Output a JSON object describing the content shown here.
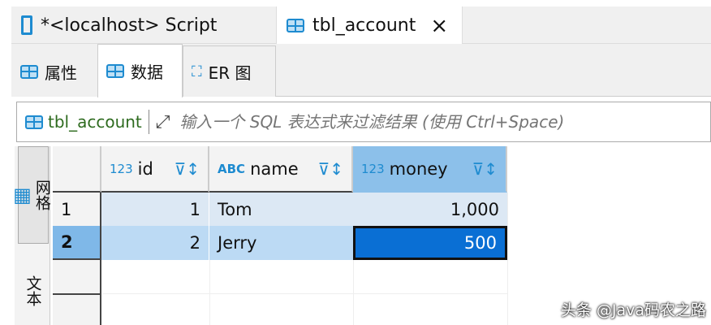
{
  "editor_tabs": [
    {
      "label": "*<localhost> Script",
      "icon": "script-icon"
    },
    {
      "label": "tbl_account",
      "icon": "table-icon",
      "close": "×"
    }
  ],
  "sub_tabs": [
    {
      "label": "属性"
    },
    {
      "label": "数据"
    },
    {
      "label": "ER 图"
    }
  ],
  "filter": {
    "table": "tbl_account",
    "placeholder": "输入一个 SQL 表达式来过滤结果 (使用 Ctrl+Space)"
  },
  "side_tabs": [
    {
      "label": "网格"
    },
    {
      "label": "文本"
    }
  ],
  "columns": [
    {
      "type": "123",
      "name": "id"
    },
    {
      "type": "ABC",
      "name": "name"
    },
    {
      "type": "123",
      "name": "money"
    }
  ],
  "rows": [
    {
      "num": "1",
      "id": "1",
      "name": "Tom",
      "money": "1,000"
    },
    {
      "num": "2",
      "id": "2",
      "name": "Jerry",
      "money": "500"
    }
  ],
  "watermark": "头条 @Java码农之路"
}
